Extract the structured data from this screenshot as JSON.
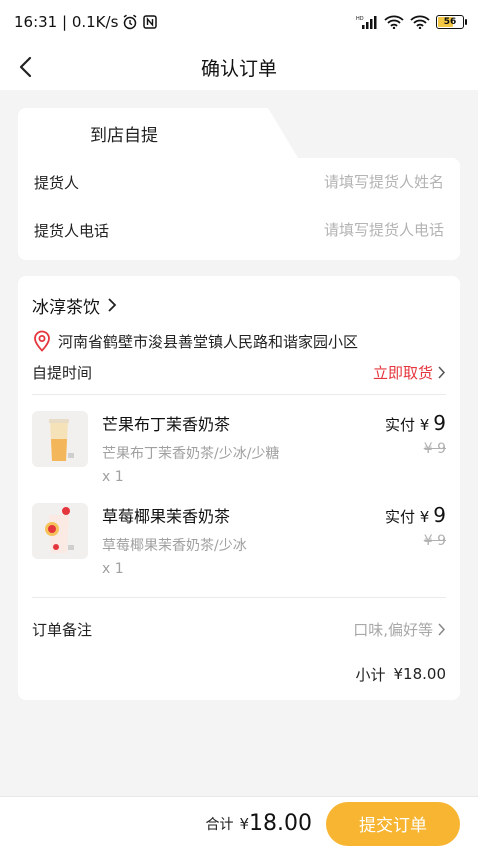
{
  "status_bar": {
    "time_speed": "16:31 | 0.1K/s",
    "battery": "56"
  },
  "nav": {
    "title": "确认订单"
  },
  "pickup": {
    "tab_label": "到店自提",
    "picker_label": "提货人",
    "picker_placeholder": "请填写提货人姓名",
    "phone_label": "提货人电话",
    "phone_placeholder": "请填写提货人电话"
  },
  "order": {
    "shop_name": "冰淳茶饮",
    "address": "河南省鹤壁市浚县善堂镇人民路和谐家园小区",
    "pickup_time_label": "自提时间",
    "pickup_time_value": "立即取货",
    "items": [
      {
        "name": "芒果布丁茉香奶茶",
        "spec": "芒果布丁茉香奶茶/少冰/少糖",
        "qty": "x 1",
        "pay_label": "实付 ¥",
        "pay_value": "9",
        "orig_price": "¥ 9"
      },
      {
        "name": "草莓椰果茉香奶茶",
        "spec": "草莓椰果茉香奶茶/少冰",
        "qty": "x 1",
        "pay_label": "实付 ¥",
        "pay_value": "9",
        "orig_price": "¥ 9"
      }
    ],
    "remark_label": "订单备注",
    "remark_value": "口味,偏好等",
    "subtotal_label": "小计",
    "subtotal_value": "¥18.00"
  },
  "footer": {
    "total_label": "合计",
    "total_currency": "¥",
    "total_amount": "18.00",
    "submit_label": "提交订单"
  },
  "colors": {
    "accent": "#f7b531",
    "highlight": "#e5363d"
  }
}
